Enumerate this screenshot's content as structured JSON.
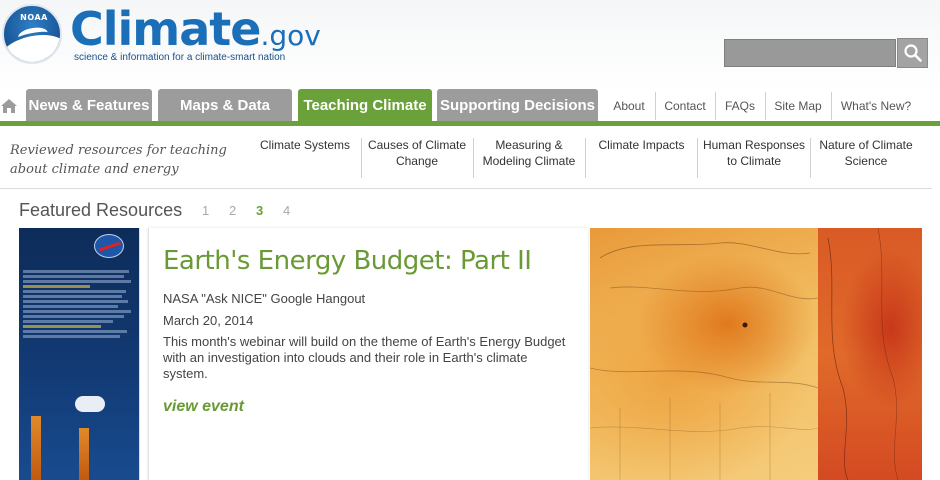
{
  "header": {
    "logo_text": "NOAA",
    "brand": "Climate",
    "brand_tld": ".gov",
    "tagline": "science & information for a climate-smart nation"
  },
  "search": {
    "value": "",
    "icon": "search-icon"
  },
  "nav": {
    "home_icon": "home-icon",
    "tabs": [
      {
        "label": "News & Features",
        "active": false
      },
      {
        "label": "Maps & Data",
        "active": false
      },
      {
        "label": "Teaching Climate",
        "active": true
      },
      {
        "label": "Supporting Decisions",
        "active": false
      }
    ],
    "utility_links": [
      "About",
      "Contact",
      "FAQs",
      "Site Map",
      "What's New?"
    ]
  },
  "subnav": {
    "description": "Reviewed resources for teaching about climate and energy",
    "items": [
      "Climate Systems",
      "Causes of Climate Change",
      "Measuring & Modeling Climate",
      "Climate Impacts",
      "Human Responses to Climate",
      "Nature of Climate Science"
    ]
  },
  "featured": {
    "title": "Featured Resources",
    "pages": [
      "1",
      "2",
      "3",
      "4"
    ],
    "current_page": "3",
    "item": {
      "title": "Earth's Energy Budget: Part II",
      "subtitle": "NASA \"Ask NICE\" Google Hangout",
      "date": "March 20, 2014",
      "description": "This month's webinar will build on the theme of Earth's Energy Budget with an investigation into clouds and their role in Earth's climate system.",
      "link": "view event"
    }
  },
  "colors": {
    "brand_blue": "#1b6fb8",
    "accent_green": "#6aa13a",
    "tab_gray": "#9c9c9c"
  }
}
